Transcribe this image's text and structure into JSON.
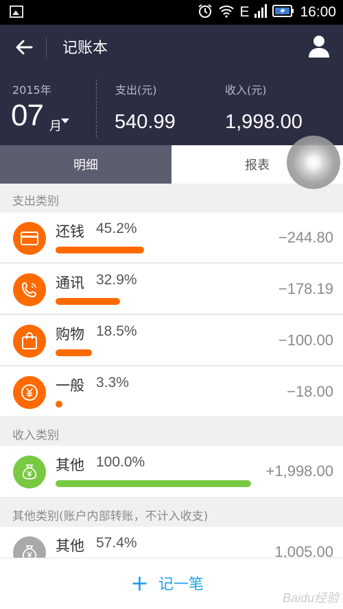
{
  "status_bar": {
    "time": "16:00",
    "network": "E",
    "icons": [
      "image-icon",
      "alarm-icon",
      "wifi-icon",
      "signal-icon",
      "battery-icon"
    ]
  },
  "header": {
    "title": "记账本",
    "year": "2015年",
    "month": "07",
    "month_unit": "月",
    "expense_label": "支出(元)",
    "expense_value": "540.99",
    "income_label": "收入(元)",
    "income_value": "1,998.00"
  },
  "tabs": [
    {
      "label": "明细",
      "active": true
    },
    {
      "label": "报表",
      "active": false
    }
  ],
  "sections": {
    "expense": "支出类别",
    "income": "收入类别",
    "other": "其他类别(账户内部转账，不计入收支)"
  },
  "expense_rows": [
    {
      "name": "还钱",
      "percent": "45.2%",
      "share": 0.452,
      "amount": "−244.80",
      "icon": "card-icon"
    },
    {
      "name": "通讯",
      "percent": "32.9%",
      "share": 0.329,
      "amount": "−178.19",
      "icon": "phone-icon"
    },
    {
      "name": "购物",
      "percent": "18.5%",
      "share": 0.185,
      "amount": "−100.00",
      "icon": "shopping-bag-icon"
    },
    {
      "name": "一般",
      "percent": "3.3%",
      "share": 0.033,
      "amount": "−18.00",
      "icon": "yen-icon"
    }
  ],
  "income_rows": [
    {
      "name": "其他",
      "percent": "100.0%",
      "share": 1.0,
      "amount": "+1,998.00",
      "icon": "money-bag-icon"
    }
  ],
  "other_rows": [
    {
      "name": "其他",
      "percent": "57.4%",
      "share": 0.574,
      "amount": "1,005.00",
      "icon": "money-bag-icon"
    }
  ],
  "bottom": {
    "add_label": "记一笔",
    "add_plus": "+"
  },
  "watermark": "Baidu经验",
  "colors": {
    "header_bg": "#2b2d42",
    "expense_accent": "#ff6a00",
    "income_accent": "#7ac943",
    "other_accent": "#a9a9a9",
    "add_button": "#1ea0e6"
  }
}
